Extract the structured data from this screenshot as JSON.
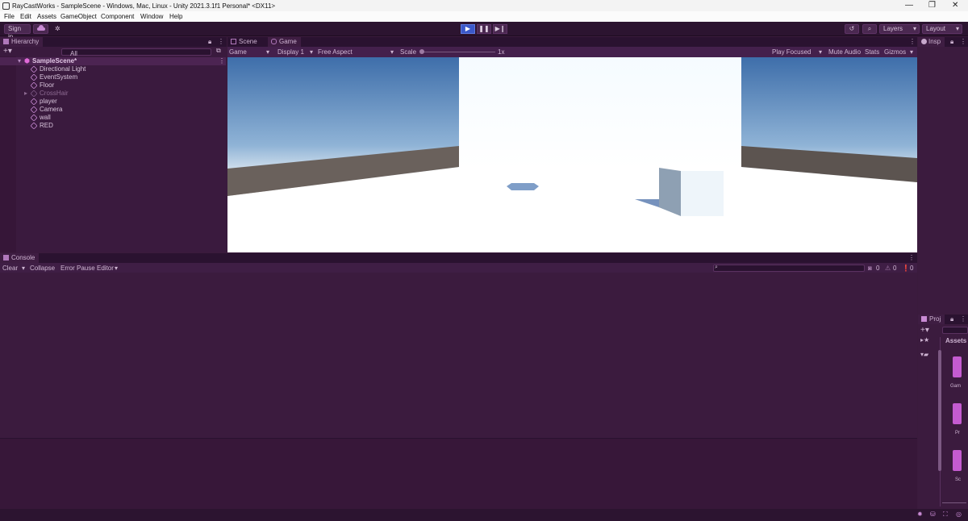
{
  "window": {
    "title": "RayCastWorks - SampleScene - Windows, Mac, Linux - Unity 2021.3.1f1 Personal* <DX11>",
    "controls": [
      "—",
      "❐",
      "✕"
    ]
  },
  "menu": [
    "File",
    "Edit",
    "Assets",
    "GameObject",
    "Component",
    "Window",
    "Help"
  ],
  "toolbar": {
    "sign_in": "Sign in",
    "layers": "Layers",
    "layout": "Layout",
    "play_state": "playing"
  },
  "hierarchy": {
    "tab": "Hierarchy",
    "search_placeholder": "All",
    "scene": "SampleScene*",
    "items": [
      {
        "label": "Directional Light",
        "disabled": false
      },
      {
        "label": "EventSystem",
        "disabled": false
      },
      {
        "label": "Floor",
        "disabled": false
      },
      {
        "label": "CrossHair",
        "disabled": true
      },
      {
        "label": "player",
        "disabled": false
      },
      {
        "label": "Camera",
        "disabled": false
      },
      {
        "label": "wall",
        "disabled": false
      },
      {
        "label": "RED",
        "disabled": false
      }
    ]
  },
  "game": {
    "tabs": [
      "Scene",
      "Game"
    ],
    "display_mode": "Game",
    "display": "Display 1",
    "aspect": "Free Aspect",
    "scale_label": "Scale",
    "scale_value": "1x",
    "play_focused": "Play Focused",
    "mute_audio": "Mute Audio",
    "stats": "Stats",
    "gizmos": "Gizmos"
  },
  "console": {
    "tab": "Console",
    "clear": "Clear",
    "collapse": "Collapse",
    "error_pause": "Error Pause",
    "editor": "Editor",
    "log_count": "0",
    "warn_count": "0",
    "error_count": "0"
  },
  "inspector": {
    "tab": "Insp"
  },
  "project": {
    "tab": "Proj",
    "assets_label": "Assets",
    "asset_items": [
      "Gam",
      "Pr",
      "Sc"
    ]
  },
  "colors": {
    "accent": "#3b58c9",
    "panel": "#3b1b3e",
    "toolbar": "#2c1430",
    "asset_tile": "#c45bd0"
  }
}
